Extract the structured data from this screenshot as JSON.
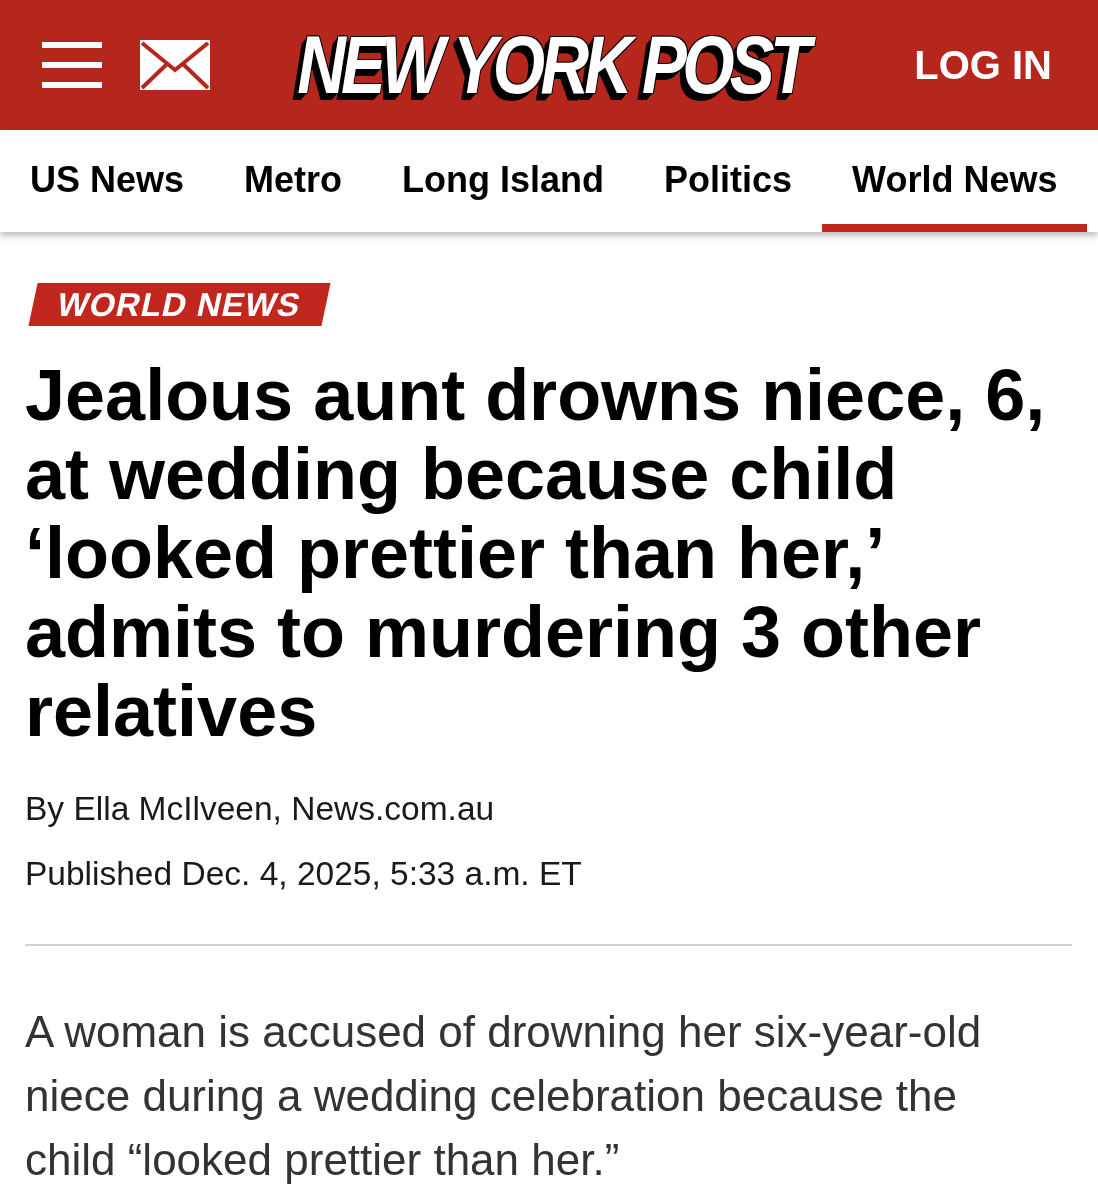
{
  "header": {
    "logo": "NEW YORK POST",
    "login": "LOG IN"
  },
  "nav": {
    "tabs": [
      {
        "label": "US News",
        "selected": false
      },
      {
        "label": "Metro",
        "selected": false
      },
      {
        "label": "Long Island",
        "selected": false
      },
      {
        "label": "Politics",
        "selected": false
      },
      {
        "label": "World News",
        "selected": true
      }
    ]
  },
  "article": {
    "section_tag": "WORLD NEWS",
    "headline": "Jealous aunt drowns niece, 6, at wedding because child ‘looked prettier than her,’ admits to murdering 3 other relatives",
    "byline": "By Ella McIlveen, News.com.au",
    "published": "Published Dec. 4, 2025, 5:33 a.m. ET",
    "body": [
      "A woman is accused of drowning her six-year-old niece during a wedding celebration because the child “looked prettier than her.”"
    ]
  }
}
